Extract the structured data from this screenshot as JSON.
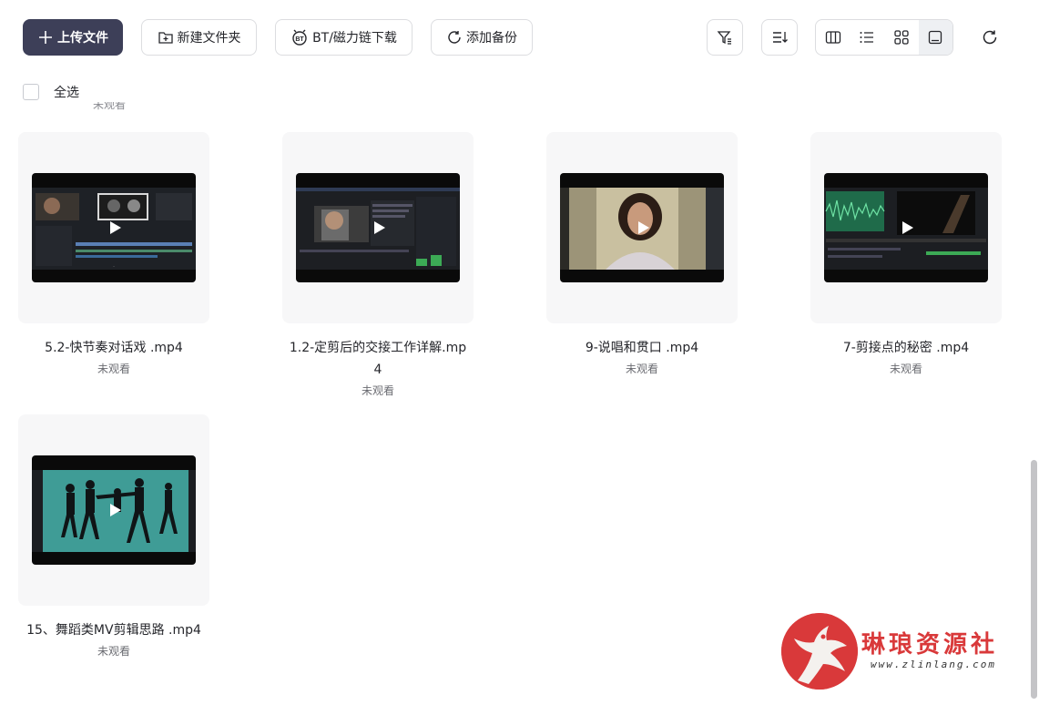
{
  "toolbar": {
    "upload_label": "上传文件",
    "new_folder_label": "新建文件夹",
    "bt_label": "BT/磁力链下载",
    "backup_label": "添加备份"
  },
  "select_all_label": "全选",
  "cutoff_status": "未观看",
  "files": [
    {
      "name": "5.2-快节奏对话戏 .mp4",
      "status": "未观看"
    },
    {
      "name": "1.2-定剪后的交接工作详解.mp4",
      "status": "未观看"
    },
    {
      "name": "9-说唱和贯口 .mp4",
      "status": "未观看"
    },
    {
      "name": "7-剪接点的秘密 .mp4",
      "status": "未观看"
    },
    {
      "name": "15、舞蹈类MV剪辑思路 .mp4",
      "status": "未观看"
    }
  ],
  "watermark": {
    "title": "琳琅资源社",
    "url": "www.zlinlang.com"
  },
  "colors": {
    "primary": "#3d3f58",
    "watermark_red": "#d9393a"
  }
}
